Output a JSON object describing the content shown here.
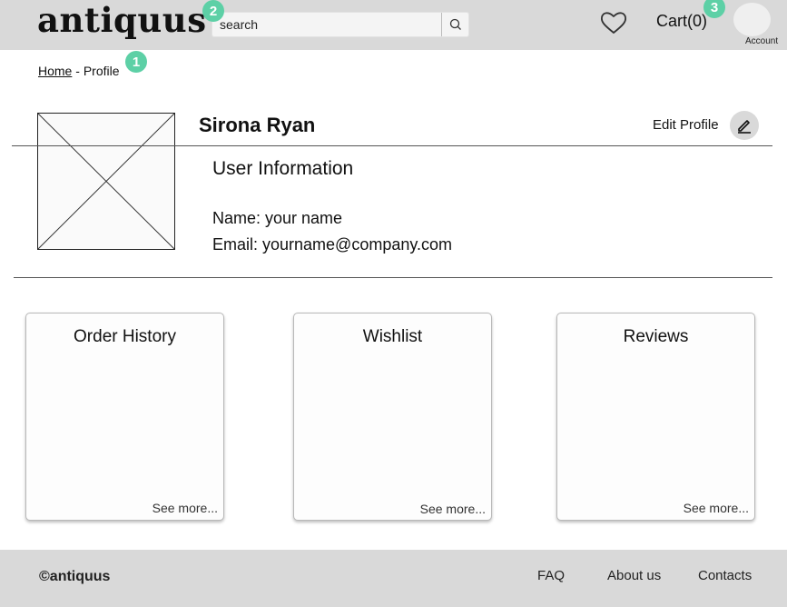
{
  "header": {
    "logo": "antiquus",
    "search_placeholder": "search",
    "cart_label": "Cart(0)",
    "account_label": "Account",
    "icons": {
      "search": "search-icon",
      "wishlist": "heart-icon",
      "avatar": "user-avatar"
    }
  },
  "markers": [
    "1",
    "2",
    "3"
  ],
  "breadcrumb": {
    "home": "Home",
    "separator": " - ",
    "current": "Profile"
  },
  "profile": {
    "name": "Sirona Ryan",
    "edit_label": "Edit Profile",
    "info_title": "User Information",
    "name_line": "Name: your name",
    "email_line": "Email: yourname@company.com"
  },
  "cards": [
    {
      "title": "Order History",
      "more": "See more..."
    },
    {
      "title": "Wishlist",
      "more": "See more..."
    },
    {
      "title": "Reviews",
      "more": "See more..."
    }
  ],
  "footer": {
    "copyright": "©antiquus",
    "links": [
      "FAQ",
      "About us",
      "Contacts"
    ]
  },
  "colors": {
    "header_bg": "#d9d9d9",
    "marker": "#5dd0a6",
    "footer_bg": "#d9d9d9"
  }
}
